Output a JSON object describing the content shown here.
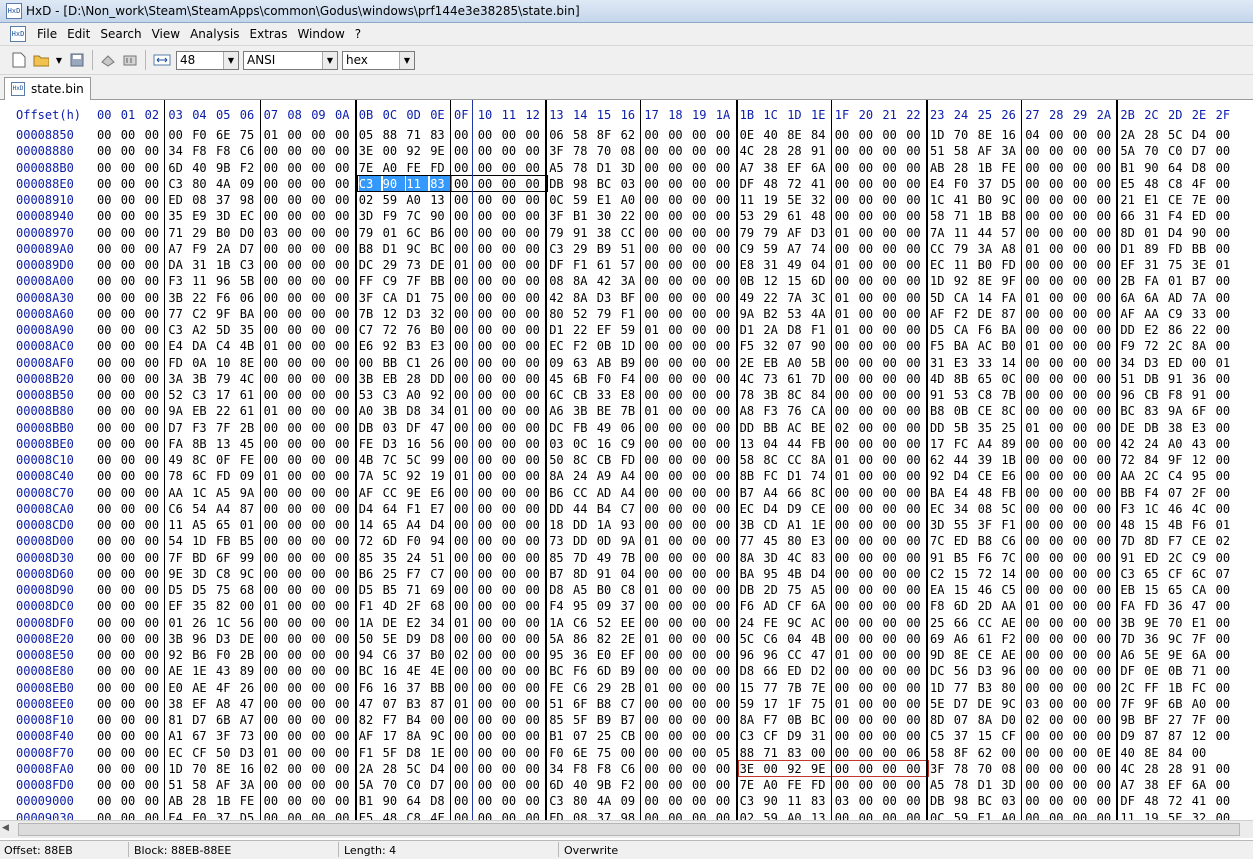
{
  "window": {
    "title": "HxD - [D:\\Non_work\\Steam\\SteamApps\\common\\Godus\\windows\\prf144e3e38285\\state.bin]"
  },
  "menu": [
    "File",
    "Edit",
    "Search",
    "View",
    "Analysis",
    "Extras",
    "Window",
    "?"
  ],
  "toolbar": {
    "bytes_per_row": "48",
    "charset": "ANSI",
    "display": "hex"
  },
  "tab": {
    "label": "state.bin"
  },
  "hex": {
    "offset_header": "Offset(h)",
    "columns": [
      "00",
      "01",
      "02",
      "03",
      "04",
      "05",
      "06",
      "07",
      "08",
      "09",
      "0A",
      "0B",
      "0C",
      "0D",
      "0E",
      "0F",
      "10",
      "11",
      "12",
      "13",
      "14",
      "15",
      "16",
      "17",
      "18",
      "19",
      "1A",
      "1B",
      "1C",
      "1D",
      "1E",
      "1F",
      "20",
      "21",
      "22",
      "23",
      "24",
      "25",
      "26",
      "27",
      "28",
      "29",
      "2A",
      "2B",
      "2C",
      "2D",
      "2E",
      "2F"
    ],
    "rows": [
      {
        "offset": "00008850",
        "bytes": "00 00 00 00 F0 6E 75 01 00 00 00 05 88 71 83 00 00 00 00 06 58 8F 62 00 00 00 00 0E 40 8E 84 00 00 00 00 1D 70 8E 16 04 00 00 00 2A 28 5C D4 00"
      },
      {
        "offset": "00008880",
        "bytes": "00 00 00 34 F8 F8 C6 00 00 00 00 3E 00 92 9E 00 00 00 00 3F 78 70 08 00 00 00 00 4C 28 28 91 00 00 00 00 51 58 AF 3A 00 00 00 00 5A 70 C0 D7 00"
      },
      {
        "offset": "000088B0",
        "bytes": "00 00 00 6D 40 9B F2 00 00 00 00 7E A0 FE FD 00 00 00 00 A5 78 D1 3D 00 00 00 00 A7 38 EF 6A 00 00 00 00 AB 28 1B FE 00 00 00 00 B1 90 64 D8 00"
      },
      {
        "offset": "000088E0",
        "bytes": "00 00 00 C3 80 4A 09 00 00 00 00 C3 90 11 83 00 00 00 00 DB 98 BC 03 00 00 00 00 DF 48 72 41 00 00 00 00 E4 F0 37 D5 00 00 00 00 E5 48 C8 4F 00"
      },
      {
        "offset": "00008910",
        "bytes": "00 00 00 ED 08 37 98 00 00 00 00 02 59 A0 13 00 00 00 00 0C 59 E1 A0 00 00 00 00 11 19 5E 32 00 00 00 00 1C 41 B0 9C 00 00 00 00 21 E1 CE 7E 00"
      },
      {
        "offset": "00008940",
        "bytes": "00 00 00 35 E9 3D EC 00 00 00 00 3D F9 7C 90 00 00 00 00 3F B1 30 22 00 00 00 00 53 29 61 48 00 00 00 00 58 71 1B B8 00 00 00 00 66 31 F4 ED 00"
      },
      {
        "offset": "00008970",
        "bytes": "00 00 00 71 29 B0 D0 03 00 00 00 79 01 6C B6 00 00 00 00 79 91 38 CC 00 00 00 00 79 79 AF D3 01 00 00 00 7A 11 44 57 00 00 00 00 8D 01 D4 90 00"
      },
      {
        "offset": "000089A0",
        "bytes": "00 00 00 A7 F9 2A D7 00 00 00 00 B8 D1 9C BC 00 00 00 00 C3 29 B9 51 00 00 00 00 C9 59 A7 74 00 00 00 00 CC 79 3A A8 01 00 00 00 D1 89 FD BB 00"
      },
      {
        "offset": "000089D0",
        "bytes": "00 00 00 DA 31 1B C3 00 00 00 00 DC 29 73 DE 01 00 00 00 DF F1 61 57 00 00 00 00 E8 31 49 04 01 00 00 00 EC 11 B0 FD 00 00 00 00 EF 31 75 3E 01"
      },
      {
        "offset": "00008A00",
        "bytes": "00 00 00 F3 11 96 5B 00 00 00 00 FF C9 7F BB 00 00 00 00 08 8A 42 3A 00 00 00 00 0B 12 15 6D 00 00 00 00 1D 92 8E 9F 00 00 00 00 2B FA 01 B7 00"
      },
      {
        "offset": "00008A30",
        "bytes": "00 00 00 3B 22 F6 06 00 00 00 00 3F CA D1 75 00 00 00 00 42 8A D3 BF 00 00 00 00 49 22 7A 3C 01 00 00 00 5D CA 14 FA 01 00 00 00 6A 6A AD 7A 00"
      },
      {
        "offset": "00008A60",
        "bytes": "00 00 00 77 C2 9F BA 00 00 00 00 7B 12 D3 32 00 00 00 00 80 52 79 F1 00 00 00 00 9A B2 53 4A 01 00 00 00 AF F2 DE 87 00 00 00 00 AF AA C9 33 00"
      },
      {
        "offset": "00008A90",
        "bytes": "00 00 00 C3 A2 5D 35 00 00 00 00 C7 72 76 B0 00 00 00 00 D1 22 EF 59 01 00 00 00 D1 2A D8 F1 01 00 00 00 D5 CA F6 BA 00 00 00 00 DD E2 86 22 00"
      },
      {
        "offset": "00008AC0",
        "bytes": "00 00 00 E4 DA C4 4B 01 00 00 00 E6 92 B3 E3 00 00 00 00 EC F2 0B 1D 00 00 00 00 F5 32 07 90 00 00 00 00 F5 BA AC B0 01 00 00 00 F9 72 2C 8A 00"
      },
      {
        "offset": "00008AF0",
        "bytes": "00 00 00 FD 0A 10 8E 00 00 00 00 00 BB C1 26 00 00 00 00 09 63 AB B9 00 00 00 00 2E EB A0 5B 00 00 00 00 31 E3 33 14 00 00 00 00 34 D3 ED 00 01"
      },
      {
        "offset": "00008B20",
        "bytes": "00 00 00 3A 3B 79 4C 00 00 00 00 3B EB 28 DD 00 00 00 00 45 6B F0 F4 00 00 00 00 4C 73 61 7D 00 00 00 00 4D 8B 65 0C 00 00 00 00 51 DB 91 36 00"
      },
      {
        "offset": "00008B50",
        "bytes": "00 00 00 52 C3 17 61 00 00 00 00 53 C3 A0 92 00 00 00 00 6C CB 33 E8 00 00 00 00 78 3B 8C 84 00 00 00 00 91 53 C8 7B 00 00 00 00 96 CB F8 91 00"
      },
      {
        "offset": "00008B80",
        "bytes": "00 00 00 9A EB 22 61 01 00 00 00 A0 3B D8 34 01 00 00 00 A6 3B BE 7B 01 00 00 00 A8 F3 76 CA 00 00 00 00 B8 0B CE 8C 00 00 00 00 BC 83 9A 6F 00"
      },
      {
        "offset": "00008BB0",
        "bytes": "00 00 00 D7 F3 7F 2B 00 00 00 00 DB 03 DF 47 00 00 00 00 DC FB 49 06 00 00 00 00 DD BB AC BE 02 00 00 00 DD 5B 35 25 01 00 00 00 DE DB 38 E3 00"
      },
      {
        "offset": "00008BE0",
        "bytes": "00 00 00 FA 8B 13 45 00 00 00 00 FE D3 16 56 00 00 00 00 03 0C 16 C9 00 00 00 00 13 04 44 FB 00 00 00 00 17 FC A4 89 00 00 00 00 42 24 A0 43 00"
      },
      {
        "offset": "00008C10",
        "bytes": "00 00 00 49 8C 0F FE 00 00 00 00 4B 7C 5C 99 00 00 00 00 50 8C CB FD 00 00 00 00 58 8C CC 8A 01 00 00 00 62 44 39 1B 00 00 00 00 72 84 9F 12 00"
      },
      {
        "offset": "00008C40",
        "bytes": "00 00 00 78 6C FD 09 01 00 00 00 7A 5C 92 19 01 00 00 00 8A 24 A9 A4 00 00 00 00 8B FC D1 74 01 00 00 00 92 D4 CE E6 00 00 00 00 AA 2C C4 95 00"
      },
      {
        "offset": "00008C70",
        "bytes": "00 00 00 AA 1C A5 9A 00 00 00 00 AF CC 9E E6 00 00 00 00 B6 CC AD A4 00 00 00 00 B7 A4 66 8C 00 00 00 00 BA E4 48 FB 00 00 00 00 BB F4 07 2F 00"
      },
      {
        "offset": "00008CA0",
        "bytes": "00 00 00 C6 54 A4 87 00 00 00 00 D4 64 F1 E7 00 00 00 00 DD 44 B4 C7 00 00 00 00 EC D4 D9 CE 00 00 00 00 EC 34 08 5C 00 00 00 00 F3 1C 46 4C 00"
      },
      {
        "offset": "00008CD0",
        "bytes": "00 00 00 11 A5 65 01 00 00 00 00 14 65 A4 D4 00 00 00 00 18 DD 1A 93 00 00 00 00 3B CD A1 1E 00 00 00 00 3D 55 3F F1 00 00 00 00 48 15 4B F6 01"
      },
      {
        "offset": "00008D00",
        "bytes": "00 00 00 54 1D FB B5 00 00 00 00 72 6D F0 94 00 00 00 00 73 DD 0D 9A 01 00 00 00 77 45 80 E3 00 00 00 00 7C ED B8 C6 00 00 00 00 7D 8D F7 CE 02"
      },
      {
        "offset": "00008D30",
        "bytes": "00 00 00 7F BD 6F 99 00 00 00 00 85 35 24 51 00 00 00 00 85 7D 49 7B 00 00 00 00 8A 3D 4C 83 00 00 00 00 91 B5 F6 7C 00 00 00 00 91 ED 2C C9 00"
      },
      {
        "offset": "00008D60",
        "bytes": "00 00 00 9E 3D C8 9C 00 00 00 00 B6 25 F7 C7 00 00 00 00 B7 8D 91 04 00 00 00 00 BA 95 4B D4 00 00 00 00 C2 15 72 14 00 00 00 00 C3 65 CF 6C 07"
      },
      {
        "offset": "00008D90",
        "bytes": "00 00 00 D5 D5 75 68 00 00 00 00 D5 B5 71 69 00 00 00 00 D8 A5 B0 C8 01 00 00 00 DB 2D 75 A5 00 00 00 00 EA 15 46 C5 00 00 00 00 EB 15 65 CA 00"
      },
      {
        "offset": "00008DC0",
        "bytes": "00 00 00 EF 35 82 00 01 00 00 00 F1 4D 2F 68 00 00 00 00 F4 95 09 37 00 00 00 00 F6 AD CF 6A 00 00 00 00 F8 6D 2D AA 01 00 00 00 FA FD 36 47 00"
      },
      {
        "offset": "00008DF0",
        "bytes": "00 00 00 01 26 1C 56 00 00 00 00 1A DE E2 34 01 00 00 00 1A C6 52 EE 00 00 00 00 24 FE 9C AC 00 00 00 00 25 66 CC AE 00 00 00 00 3B 9E 70 E1 00"
      },
      {
        "offset": "00008E20",
        "bytes": "00 00 00 3B 96 D3 DE 00 00 00 00 50 5E D9 D8 00 00 00 00 5A 86 82 2E 01 00 00 00 5C C6 04 4B 00 00 00 00 69 A6 61 F2 00 00 00 00 7D 36 9C 7F 00"
      },
      {
        "offset": "00008E50",
        "bytes": "00 00 00 92 B6 F0 2B 00 00 00 00 94 C6 37 B0 02 00 00 00 95 36 E0 EF 00 00 00 00 96 96 CC 47 01 00 00 00 9D 8E CE AE 00 00 00 00 A6 5E 9E 6A 00"
      },
      {
        "offset": "00008E80",
        "bytes": "00 00 00 AE 1E 43 89 00 00 00 00 BC 16 4E 4E 00 00 00 00 BC F6 6D B9 00 00 00 00 D8 66 ED D2 00 00 00 00 DC 56 D3 96 00 00 00 00 DF 0E 0B 71 00"
      },
      {
        "offset": "00008EB0",
        "bytes": "00 00 00 E0 AE 4F 26 00 00 00 00 F6 16 37 BB 00 00 00 00 FE C6 29 2B 01 00 00 00 15 77 7B 7E 00 00 00 00 1D 77 B3 80 00 00 00 00 2C FF 1B FC 00"
      },
      {
        "offset": "00008EE0",
        "bytes": "00 00 00 38 EF A8 47 00 00 00 00 47 07 B3 87 01 00 00 00 51 6F B8 C7 00 00 00 00 59 17 1F 75 01 00 00 00 5E D7 DE 9C 03 00 00 00 7F 9F 6B A0 00"
      },
      {
        "offset": "00008F10",
        "bytes": "00 00 00 81 D7 6B A7 00 00 00 00 82 F7 B4 00 00 00 00 00 85 5F B9 B7 00 00 00 00 8A F7 0B BC 00 00 00 00 8D 07 8A D0 02 00 00 00 9B BF 27 7F 00"
      },
      {
        "offset": "00008F40",
        "bytes": "00 00 00 A1 67 3F 73 00 00 00 00 AF 17 8A 9C 00 00 00 00 B1 07 25 CB 00 00 00 00 C3 CF D9 31 00 00 00 00 C5 37 15 CF 00 00 00 00 D9 87 87 12 00"
      },
      {
        "offset": "00008F70",
        "bytes": "00 00 00 EC CF 50 D3 01 00 00 00 F1 5F D8 1E 00 00 00 00 F0 6E 75 00 00 00 00 05 88 71 83 00 00 00 00 06 58 8F 62 00 00 00 00 0E 40 8E 84 00"
      },
      {
        "offset": "00008FA0",
        "bytes": "00 00 00 1D 70 8E 16 02 00 00 00 2A 28 5C D4 00 00 00 00 34 F8 F8 C6 00 00 00 00 3E 00 92 9E 00 00 00 00 3F 78 70 08 00 00 00 00 4C 28 28 91 00"
      },
      {
        "offset": "00008FD0",
        "bytes": "00 00 00 51 58 AF 3A 00 00 00 00 5A 70 C0 D7 00 00 00 00 6D 40 9B F2 00 00 00 00 7E A0 FE FD 00 00 00 00 A5 78 D1 3D 00 00 00 00 A7 38 EF 6A 00"
      },
      {
        "offset": "00009000",
        "bytes": "00 00 00 AB 28 1B FE 00 00 00 00 B1 90 64 D8 00 00 00 00 C3 80 4A 09 00 00 00 00 C3 90 11 83 03 00 00 00 DB 98 BC 03 00 00 00 00 DF 48 72 41 00"
      },
      {
        "offset": "00009030",
        "bytes": "00 00 00 E4 F0 37 D5 00 00 00 00 E5 48 C8 4F 00 00 00 00 ED 08 37 98 00 00 00 00 02 59 A0 13 00 00 00 00 0C 59 E1 A0 00 00 00 00 11 19 5E 32 00"
      }
    ]
  },
  "status": {
    "offset": "Offset: 88EB",
    "block": "Block: 88EB-88EE",
    "length": "Length: 4",
    "mode": "Overwrite"
  }
}
